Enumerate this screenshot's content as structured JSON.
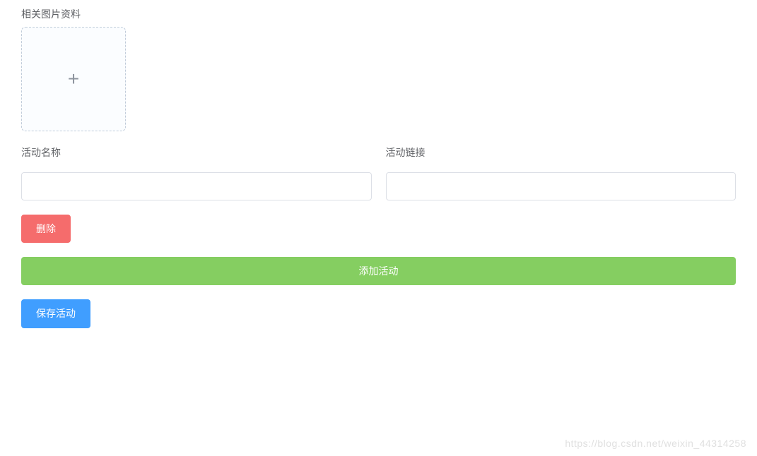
{
  "upload": {
    "label": "相关图片资料"
  },
  "fields": {
    "name_label": "活动名称",
    "name_value": "",
    "link_label": "活动链接",
    "link_value": ""
  },
  "buttons": {
    "delete_label": "删除",
    "add_label": "添加活动",
    "save_label": "保存活动"
  },
  "watermark": "https://blog.csdn.net/weixin_44314258"
}
